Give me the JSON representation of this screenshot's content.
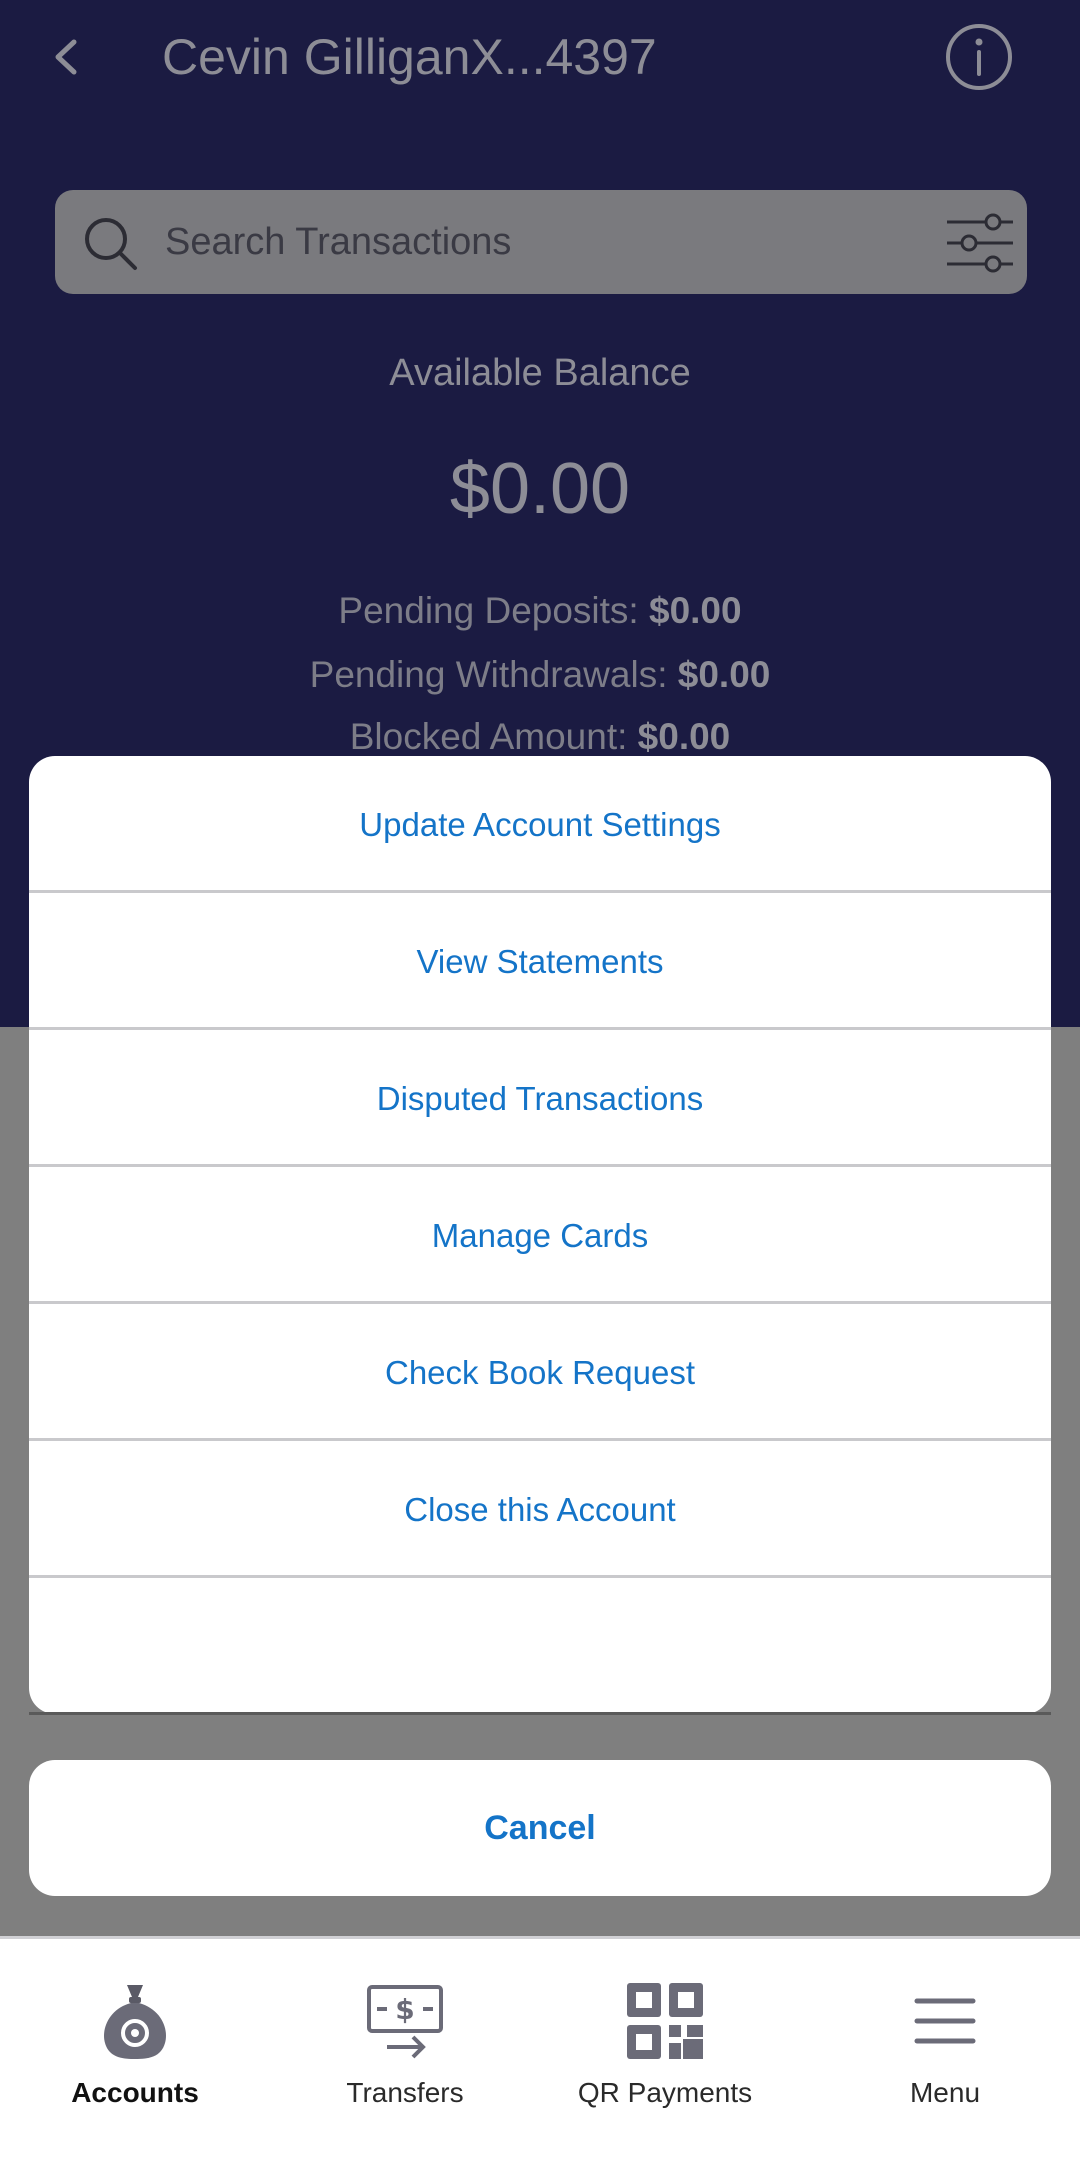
{
  "header": {
    "title": "Cevin GilliganX...4397"
  },
  "search": {
    "placeholder": "Search Transactions"
  },
  "balance": {
    "label": "Available Balance",
    "value": "$0.00",
    "pending_deposits_label": "Pending Deposits:",
    "pending_deposits_value": "$0.00",
    "pending_withdrawals_label": "Pending Withdrawals:",
    "pending_withdrawals_value": "$0.00",
    "blocked_label": "Blocked Amount:",
    "blocked_value": "$0.00"
  },
  "action_sheet": {
    "items": [
      {
        "label": "Update Account Settings"
      },
      {
        "label": "View Statements"
      },
      {
        "label": "Disputed Transactions"
      },
      {
        "label": "Manage Cards"
      },
      {
        "label": "Check Book Request"
      },
      {
        "label": "Close this Account"
      }
    ],
    "cancel_label": "Cancel"
  },
  "bottom_nav": {
    "items": [
      {
        "label": "Accounts",
        "icon": "money-bag-icon",
        "active": true
      },
      {
        "label": "Transfers",
        "icon": "transfer-icon",
        "active": false
      },
      {
        "label": "QR Payments",
        "icon": "qr-code-icon",
        "active": false
      },
      {
        "label": "Menu",
        "icon": "hamburger-icon",
        "active": false
      }
    ]
  },
  "colors": {
    "header_bg": "#1b1b42",
    "accent": "#1474c8",
    "overlay": "#7f7f7f"
  }
}
